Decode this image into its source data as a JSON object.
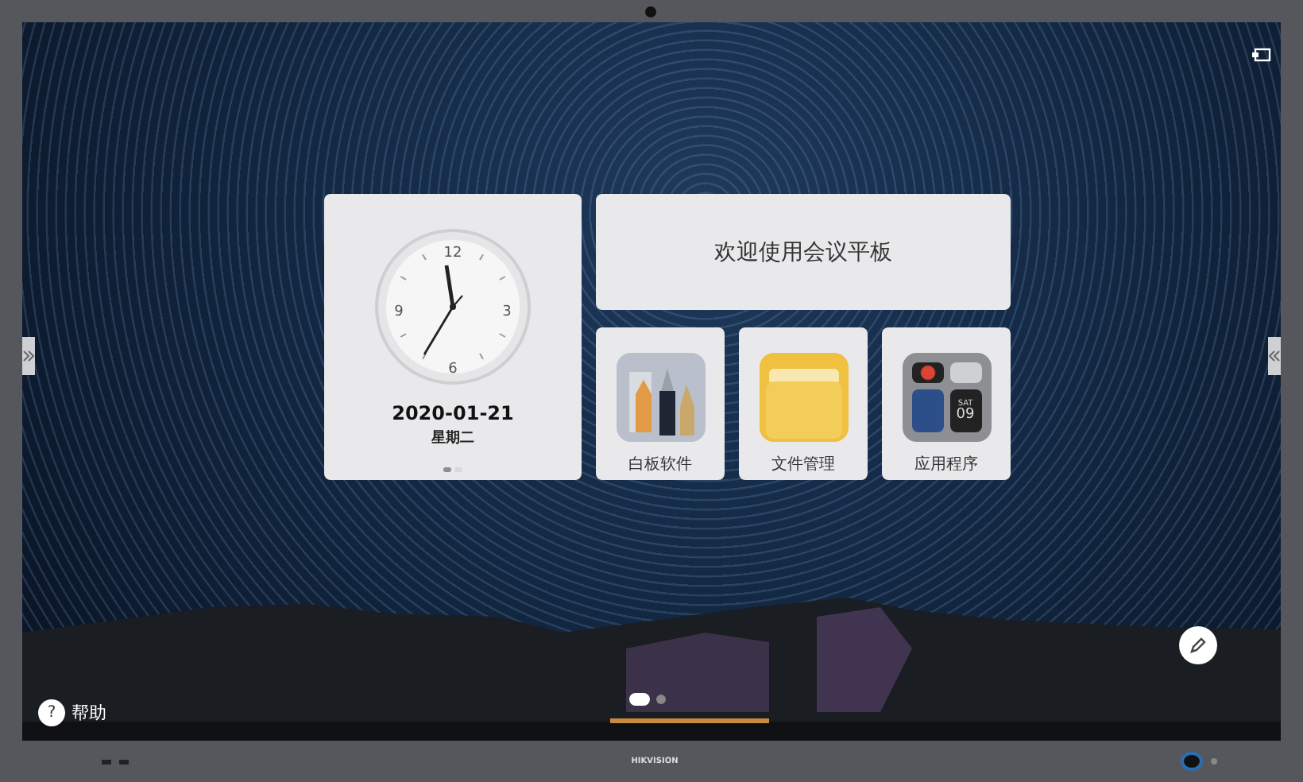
{
  "clock_card": {
    "numerals": [
      "12",
      "3",
      "6",
      "9"
    ],
    "date": "2020-01-21",
    "weekday": "星期二",
    "pages": [
      {
        "selected": true
      },
      {
        "selected": false
      }
    ]
  },
  "welcome": "欢迎使用会议平板",
  "apps": [
    {
      "label": "白板软件",
      "kind": "whiteboard"
    },
    {
      "label": "文件管理",
      "kind": "files"
    },
    {
      "label": "应用程序",
      "kind": "apps",
      "calendar_day": "SAT",
      "calendar_date": "09"
    }
  ],
  "help": {
    "icon": "?",
    "label": "帮助"
  },
  "home_pages": [
    {
      "selected": true
    },
    {
      "selected": false
    }
  ],
  "bezel": {
    "brand": "HIKVISION"
  }
}
